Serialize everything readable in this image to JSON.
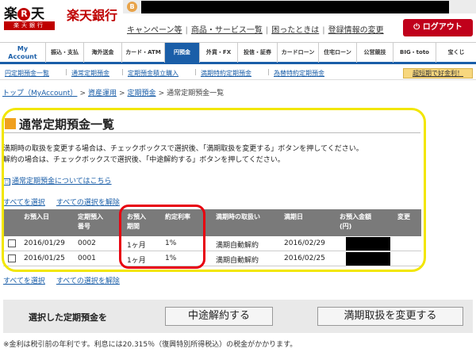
{
  "header": {
    "logo_main": "楽",
    "logo_circle": "R",
    "logo_end": "天",
    "logo_sub": "楽天銀行",
    "brand_name": "楽天銀行",
    "b_icon_letter": "B",
    "links": [
      "キャンペーン等",
      "商品・サービス一覧",
      "困ったときは",
      "登録情報の変更"
    ],
    "logout_label": "ログアウト"
  },
  "nav": {
    "items": [
      {
        "label_line1": "My",
        "label_line2": "Account"
      },
      {
        "label": "振込・支払"
      },
      {
        "label": "海外送金"
      },
      {
        "label": "カード・ATM"
      },
      {
        "label": "円預金"
      },
      {
        "label": "外貨・FX"
      },
      {
        "label": "投信・証券"
      },
      {
        "label": "カードローン"
      },
      {
        "label": "住宅ローン"
      },
      {
        "label": "公営競技"
      },
      {
        "label": "BIG・toto"
      },
      {
        "label": "宝くじ"
      }
    ],
    "active_index": 4
  },
  "subnav": {
    "items": [
      "円定期預金一覧",
      "通常定期預金",
      "定期預金積立購入",
      "満期特約定期預金",
      "為替特約定期預金"
    ],
    "promo": "超短期で好金利！"
  },
  "breadcrumb": [
    "トップ（MyAccount）",
    "資産運用",
    "定期預金",
    "通常定期預金一覧"
  ],
  "page_title": "通常定期預金一覧",
  "notes": [
    "満期時の取扱を変更する場合は、チェックボックスで選択後、「満期取扱を変更する」ボタンを押してください。",
    "解約の場合は、チェックボックスで選択後、「中途解約する」ボタンを押してください。"
  ],
  "info_link": "通常定期預金についてはこちら",
  "select_all": "すべてを選択",
  "deselect_all": "すべての選択を解除",
  "table": {
    "headers": {
      "deposit_date": "お預入日",
      "number_l1": "定期預入",
      "number_l2": "番号",
      "period_l1": "お預入",
      "period_l2": "期間",
      "rate": "約定利率",
      "maturity_handling": "満期時の取扱い",
      "maturity_date": "満期日",
      "amount_l1": "お預入金額",
      "amount_l2": "(円)",
      "change": "変更"
    },
    "rows": [
      {
        "deposit_date": "2016/01/29",
        "number": "0002",
        "period": "1ヶ月",
        "rate": "1%",
        "handling": "満期自動解約",
        "maturity_date": "2016/02/29"
      },
      {
        "deposit_date": "2016/01/25",
        "number": "0001",
        "period": "1ヶ月",
        "rate": "1%",
        "handling": "満期自動解約",
        "maturity_date": "2016/02/25"
      }
    ]
  },
  "action_panel": {
    "label": "選択した定期預金を",
    "cancel_button": "中途解約する",
    "change_button": "満期取扱を変更する"
  },
  "footnote": "※金利は税引前の年利です。利息には20.315％（復興特別所得税込）の税金がかかります。",
  "colors": {
    "brand_red": "#bf0000",
    "nav_blue": "#1a5ea8",
    "highlight_yellow": "#f2e600",
    "highlight_red": "#e8000f"
  }
}
